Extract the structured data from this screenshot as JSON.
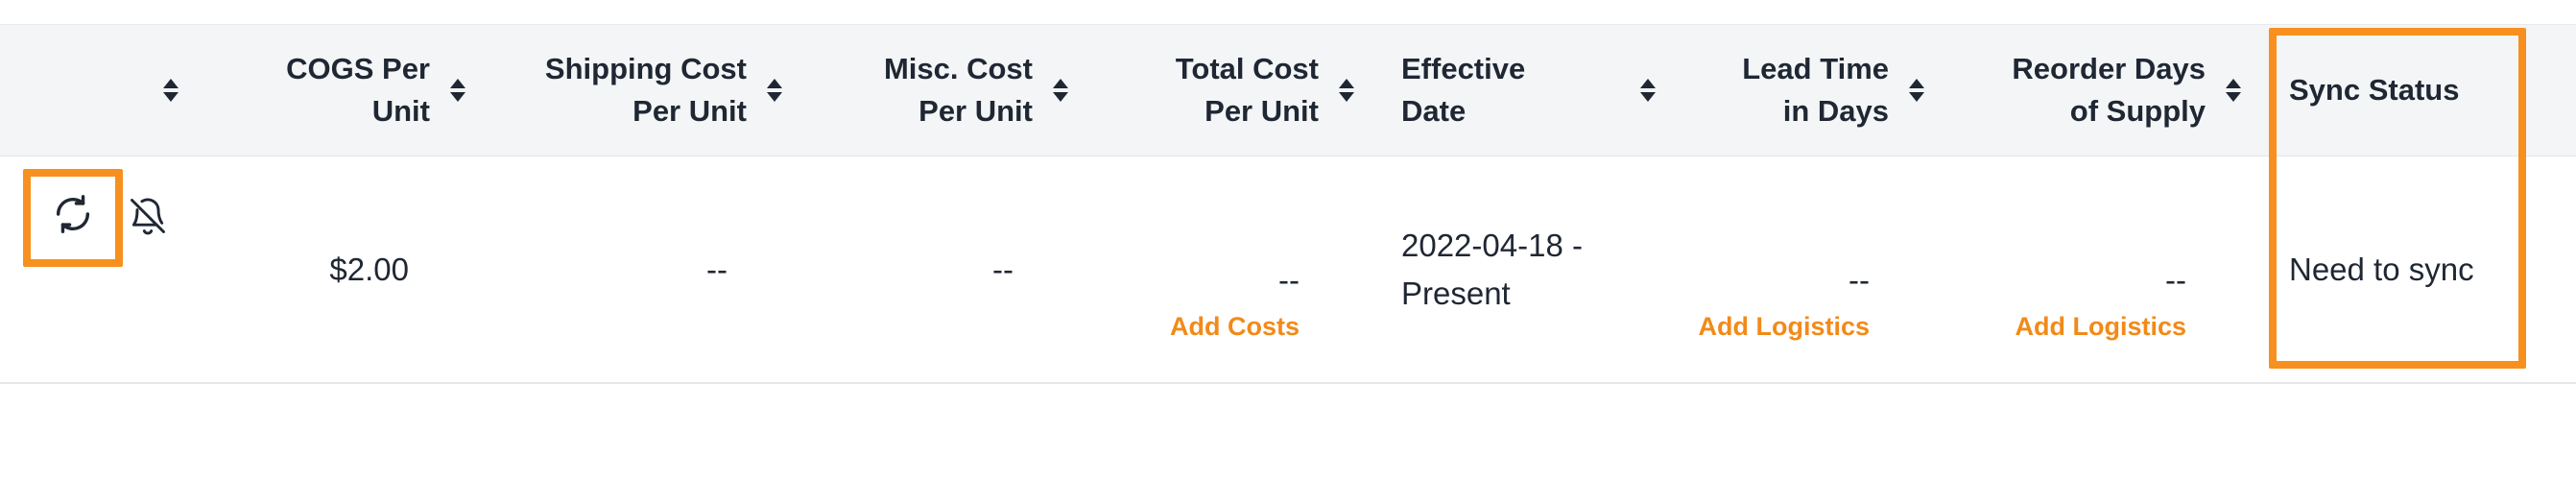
{
  "table": {
    "columns": [
      {
        "id": "actions",
        "label": "",
        "sortable": true
      },
      {
        "id": "cogs",
        "label_lines": [
          "COGS Per",
          "Unit"
        ],
        "sortable": true
      },
      {
        "id": "shipping",
        "label_lines": [
          "Shipping Cost",
          "Per Unit"
        ],
        "sortable": true
      },
      {
        "id": "misc",
        "label_lines": [
          "Misc. Cost",
          "Per Unit"
        ],
        "sortable": true
      },
      {
        "id": "total",
        "label_lines": [
          "Total Cost",
          "Per Unit"
        ],
        "sortable": true
      },
      {
        "id": "effective",
        "label_lines": [
          "Effective",
          "Date"
        ],
        "sortable": true
      },
      {
        "id": "lead",
        "label_lines": [
          "Lead Time",
          "in Days"
        ],
        "sortable": true
      },
      {
        "id": "reorder",
        "label_lines": [
          "Reorder Days",
          "of Supply"
        ],
        "sortable": true
      },
      {
        "id": "sync",
        "label": "Sync Status",
        "sortable": false
      }
    ],
    "row": {
      "icons": [
        "sync-icon",
        "bell-off-icon"
      ],
      "cogs": "$2.00",
      "shipping": "--",
      "misc": "--",
      "total": "--",
      "total_link": "Add Costs",
      "effective_lines": [
        "2022-04-18 -",
        "Present"
      ],
      "lead": "--",
      "lead_link": "Add Logistics",
      "reorder": "--",
      "reorder_link": "Add Logistics",
      "sync": "Need to sync"
    }
  },
  "colors": {
    "accent": "#f28a18",
    "highlight": "#f7901e",
    "header_bg": "#f3f5f7",
    "text": "#1f2733"
  }
}
